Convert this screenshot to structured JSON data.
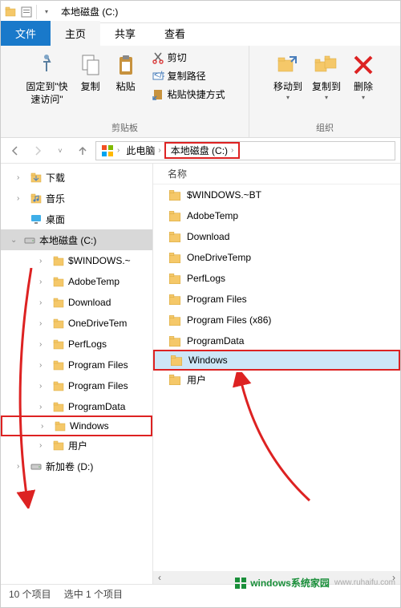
{
  "window": {
    "title": "本地磁盘 (C:)"
  },
  "tabs": {
    "file": "文件",
    "home": "主页",
    "share": "共享",
    "view": "查看"
  },
  "ribbon": {
    "pin": "固定到\"快\n速访问\"",
    "copy": "复制",
    "paste": "粘贴",
    "cut": "剪切",
    "copy_path": "复制路径",
    "paste_shortcut": "粘贴快捷方式",
    "clipboard": "剪贴板",
    "move_to": "移动到",
    "copy_to": "复制到",
    "delete": "删除",
    "organize": "组织"
  },
  "breadcrumbs": {
    "this_pc": "此电脑",
    "drive_c": "本地磁盘 (C:)"
  },
  "tree": {
    "downloads": "下载",
    "music": "音乐",
    "desktop": "桌面",
    "drive_c": "本地磁盘 (C:)",
    "items": [
      "$WINDOWS.~",
      "AdobeTemp",
      "Download",
      "OneDriveTem",
      "PerfLogs",
      "Program Files",
      "Program Files",
      "ProgramData",
      "Windows",
      "用户"
    ],
    "drive_d": "新加卷 (D:)"
  },
  "list": {
    "header_name": "名称",
    "items": [
      "$WINDOWS.~BT",
      "AdobeTemp",
      "Download",
      "OneDriveTemp",
      "PerfLogs",
      "Program Files",
      "Program Files (x86)",
      "ProgramData",
      "Windows",
      "用户"
    ]
  },
  "status": {
    "count": "10 个项目",
    "selected": "选中 1 个项目"
  },
  "watermark": {
    "text": "windows系统家园",
    "url": "www.ruhaifu.com"
  }
}
